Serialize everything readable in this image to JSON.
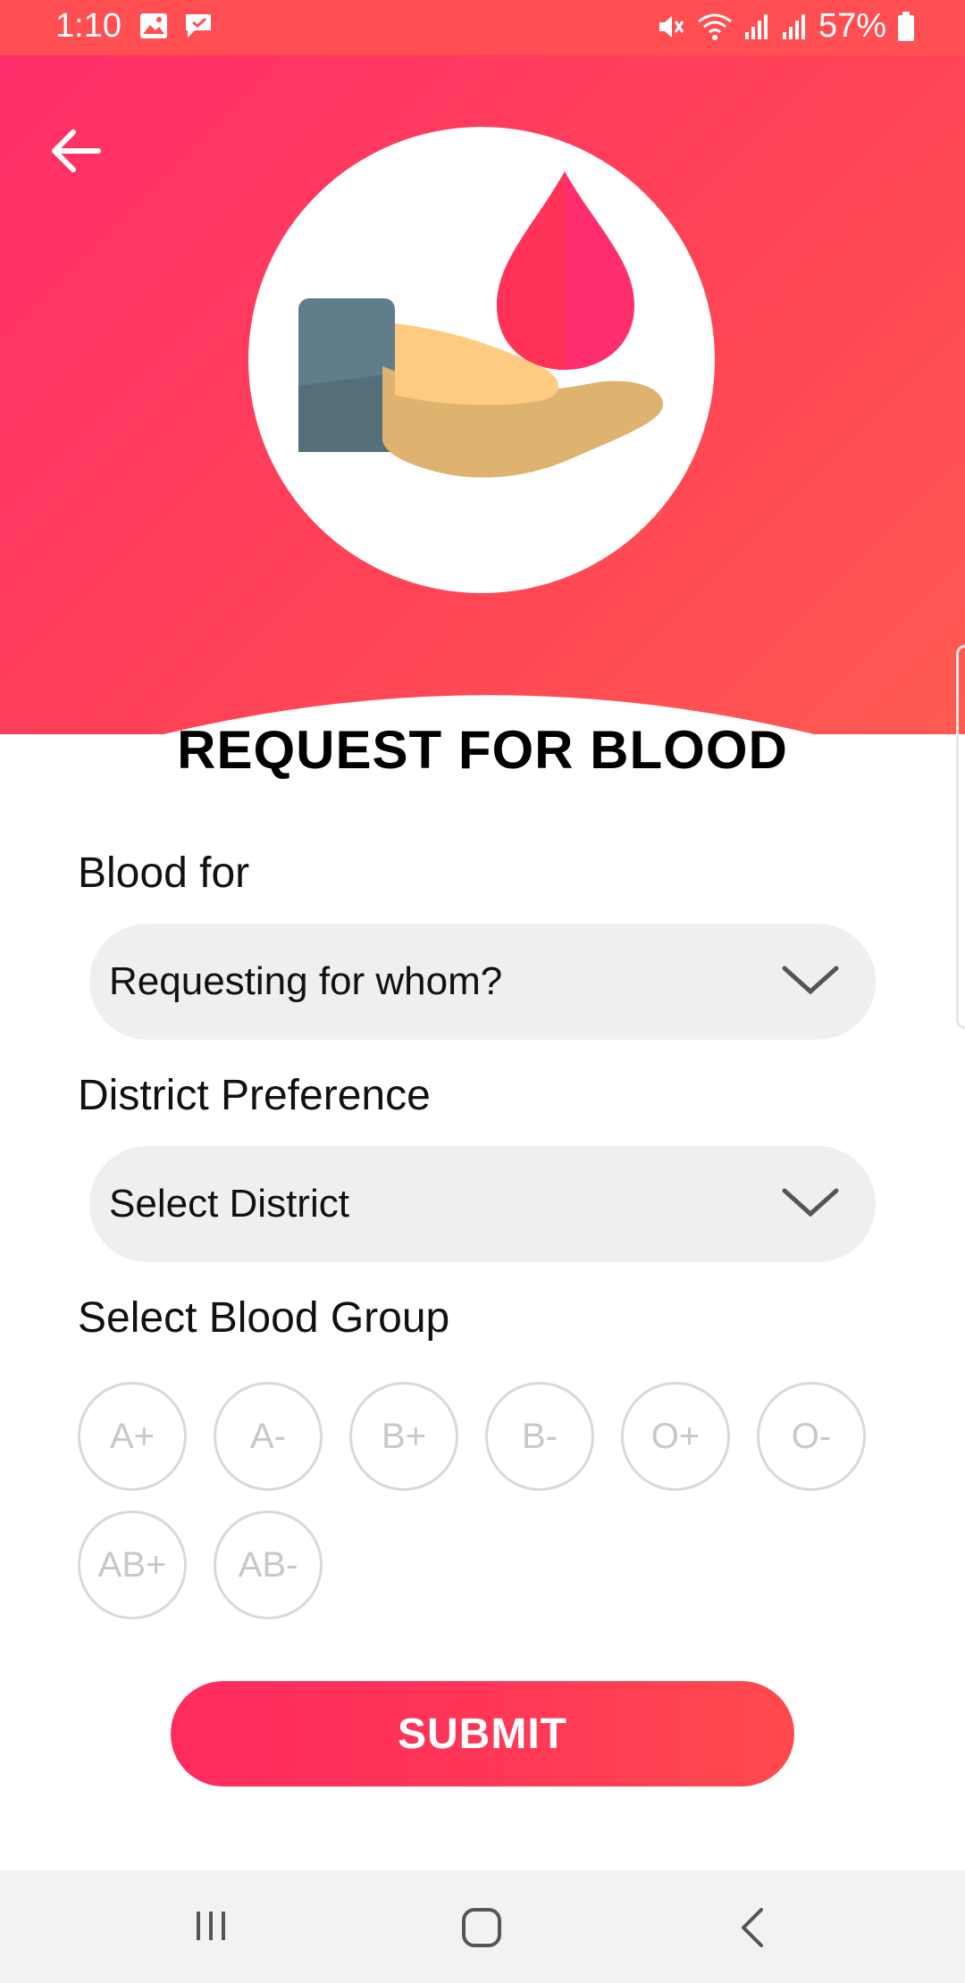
{
  "status_bar": {
    "time": "1:10",
    "battery": "57%"
  },
  "icons": {
    "back": "arrow-left-icon",
    "hero": "blood-donation-icon",
    "chevron": "chevron-down-icon"
  },
  "colors": {
    "accent": "#ff3358",
    "accent_end": "#ff4a4c",
    "chip_border": "#d9d9d9"
  },
  "form": {
    "title": "REQUEST FOR BLOOD",
    "blood_for": {
      "label": "Blood for",
      "value": "Requesting for whom?"
    },
    "district": {
      "label": "District Preference",
      "value": "Select District"
    },
    "blood_group": {
      "label": "Select Blood Group",
      "options": [
        "A+",
        "A-",
        "B+",
        "B-",
        "O+",
        "O-",
        "AB+",
        "AB-"
      ]
    },
    "submit_label": "SUBMIT"
  }
}
